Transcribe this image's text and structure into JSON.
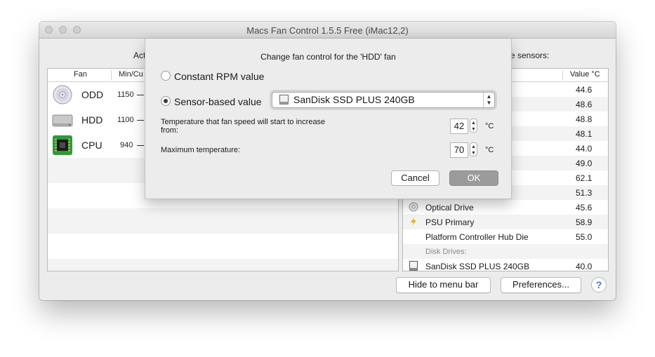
{
  "window": {
    "title": "Macs Fan Control 1.5.5 Free (iMac12,2)"
  },
  "partial_labels": {
    "left": "Act",
    "right": "e sensors:"
  },
  "fan_table": {
    "col_fan": "Fan",
    "col_rpm": "Min/Cu",
    "fans": [
      {
        "name": "ODD",
        "rpm": "1150",
        "icon": "optical-disc-icon"
      },
      {
        "name": "HDD",
        "rpm": "1100",
        "icon": "hard-drive-icon"
      },
      {
        "name": "CPU",
        "rpm": "940",
        "icon": "cpu-chip-icon"
      }
    ]
  },
  "sensor_table": {
    "col_value": "Value °C",
    "rows": [
      {
        "name": "",
        "value": "44.6"
      },
      {
        "name": "",
        "value": "48.6"
      },
      {
        "name": "",
        "value": "48.8"
      },
      {
        "name": "",
        "value": "48.1"
      },
      {
        "name": "",
        "value": "44.0"
      },
      {
        "name": "",
        "value": "49.0"
      },
      {
        "name": "",
        "value": "62.1"
      },
      {
        "name": "",
        "value": "51.3"
      },
      {
        "name": "Optical Drive",
        "value": "45.6",
        "icon": "optical-disc-icon"
      },
      {
        "name": "PSU Primary",
        "value": "58.9",
        "icon": "lightning-icon"
      },
      {
        "name": "Platform Controller Hub Die",
        "value": "55.0"
      },
      {
        "name": "Disk Drives:",
        "value": "",
        "group": true
      },
      {
        "name": "SanDisk SSD PLUS 240GB",
        "value": "40.0",
        "icon": "disk-drive-icon"
      }
    ]
  },
  "buttons": {
    "hide_menu_bar": "Hide to menu bar",
    "preferences": "Preferences...",
    "help": "?"
  },
  "dialog": {
    "title": "Change fan control for the 'HDD' fan",
    "option_constant": "Constant RPM value",
    "option_sensor": "Sensor-based value",
    "selected_option": "sensor",
    "sensor_select": "SanDisk SSD PLUS 240GB",
    "start_temp_label_line1": "Temperature that fan speed will start to increase",
    "start_temp_label_line2": "from:",
    "start_temp_value": "42",
    "max_temp_label": "Maximum temperature:",
    "max_temp_value": "70",
    "unit": "°C",
    "cancel": "Cancel",
    "ok": "OK"
  },
  "colors": {
    "ok_button_bg": "#9b9b9b",
    "help_accent": "#3a7bd5"
  }
}
